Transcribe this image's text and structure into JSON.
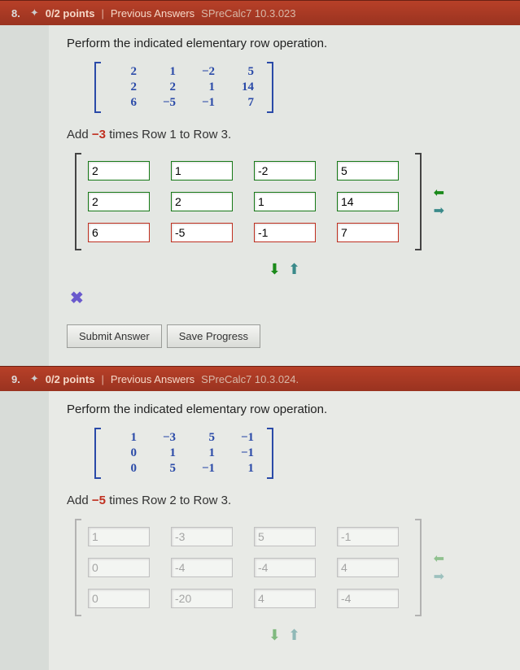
{
  "q8": {
    "number": "8.",
    "points": "0/2 points",
    "prev_label": "Previous Answers",
    "ref": "SPreCalc7 10.3.023",
    "prompt": "Perform the indicated elementary row operation.",
    "matrix": [
      [
        "2",
        "1",
        "−2",
        "5"
      ],
      [
        "2",
        "2",
        "1",
        "14"
      ],
      [
        "6",
        "−5",
        "−1",
        "7"
      ]
    ],
    "instr_pre": "Add ",
    "instr_neg": "−3",
    "instr_post": " times Row 1 to Row 3.",
    "answers": {
      "r1": [
        "2",
        "1",
        "-2",
        "5"
      ],
      "r2": [
        "2",
        "2",
        "1",
        "14"
      ],
      "r3": [
        "6",
        "-5",
        "-1",
        "7"
      ]
    },
    "wrong_mark": "✖",
    "submit": "Submit Answer",
    "save": "Save Progress"
  },
  "q9": {
    "number": "9.",
    "points": "0/2 points",
    "prev_label": "Previous Answers",
    "ref": "SPreCalc7 10.3.024.",
    "prompt": "Perform the indicated elementary row operation.",
    "matrix": [
      [
        "1",
        "−3",
        "5",
        "−1"
      ],
      [
        "0",
        "1",
        "1",
        "−1"
      ],
      [
        "0",
        "5",
        "−1",
        "1"
      ]
    ],
    "instr_pre": "Add ",
    "instr_neg": "−5",
    "instr_post": " times Row 2 to Row 3.",
    "answers": {
      "r1": [
        "1",
        "-3",
        "5",
        "-1"
      ],
      "r2": [
        "0",
        "-4",
        "-4",
        "4"
      ],
      "r3": [
        "0",
        "-20",
        "4",
        "-4"
      ]
    }
  },
  "icons": {
    "arrow_left": "⬅",
    "arrow_right": "➡",
    "arrow_down": "⬇",
    "arrow_up": "⬆",
    "gear": "✦"
  }
}
